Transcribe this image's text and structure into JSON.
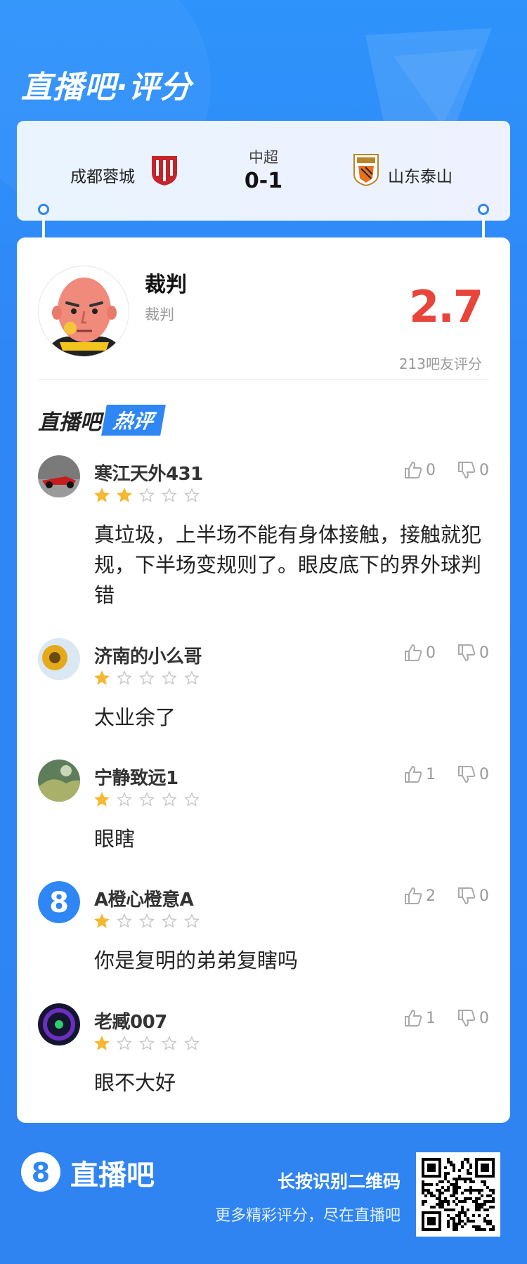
{
  "brand_title": "直播吧·评分",
  "match": {
    "league": "中超",
    "score": "0-1",
    "home_team": "成都蓉城",
    "away_team": "山东泰山"
  },
  "rated": {
    "name": "裁判",
    "role": "裁判",
    "rating": "2.7",
    "votes": "213吧友评分"
  },
  "hot_section": {
    "prefix": "直播吧",
    "badge": "热评"
  },
  "comments": [
    {
      "user": "寒江天外431",
      "stars": 2,
      "likes": "0",
      "dislikes": "0",
      "text": "真垃圾，上半场不能有身体接触，接触就犯规，下半场变规则了。眼皮底下的界外球判错"
    },
    {
      "user": "济南的小么哥",
      "stars": 1,
      "likes": "0",
      "dislikes": "0",
      "text": "太业余了"
    },
    {
      "user": "宁静致远1",
      "stars": 1,
      "likes": "1",
      "dislikes": "0",
      "text": "眼瞎"
    },
    {
      "user": "A橙心橙意A",
      "stars": 1,
      "likes": "2",
      "dislikes": "0",
      "text": "你是复明的弟弟复瞎吗"
    },
    {
      "user": "老臧007",
      "stars": 1,
      "likes": "1",
      "dislikes": "0",
      "text": "眼不大好"
    }
  ],
  "footer": {
    "brand": "直播吧",
    "line1": "长按识别二维码",
    "line2": "更多精彩评分，尽在直播吧"
  },
  "colors": {
    "background": "#2f86f5",
    "rating": "#e8443a",
    "star_on": "#f5b82e",
    "star_off": "#c8c8c8"
  }
}
